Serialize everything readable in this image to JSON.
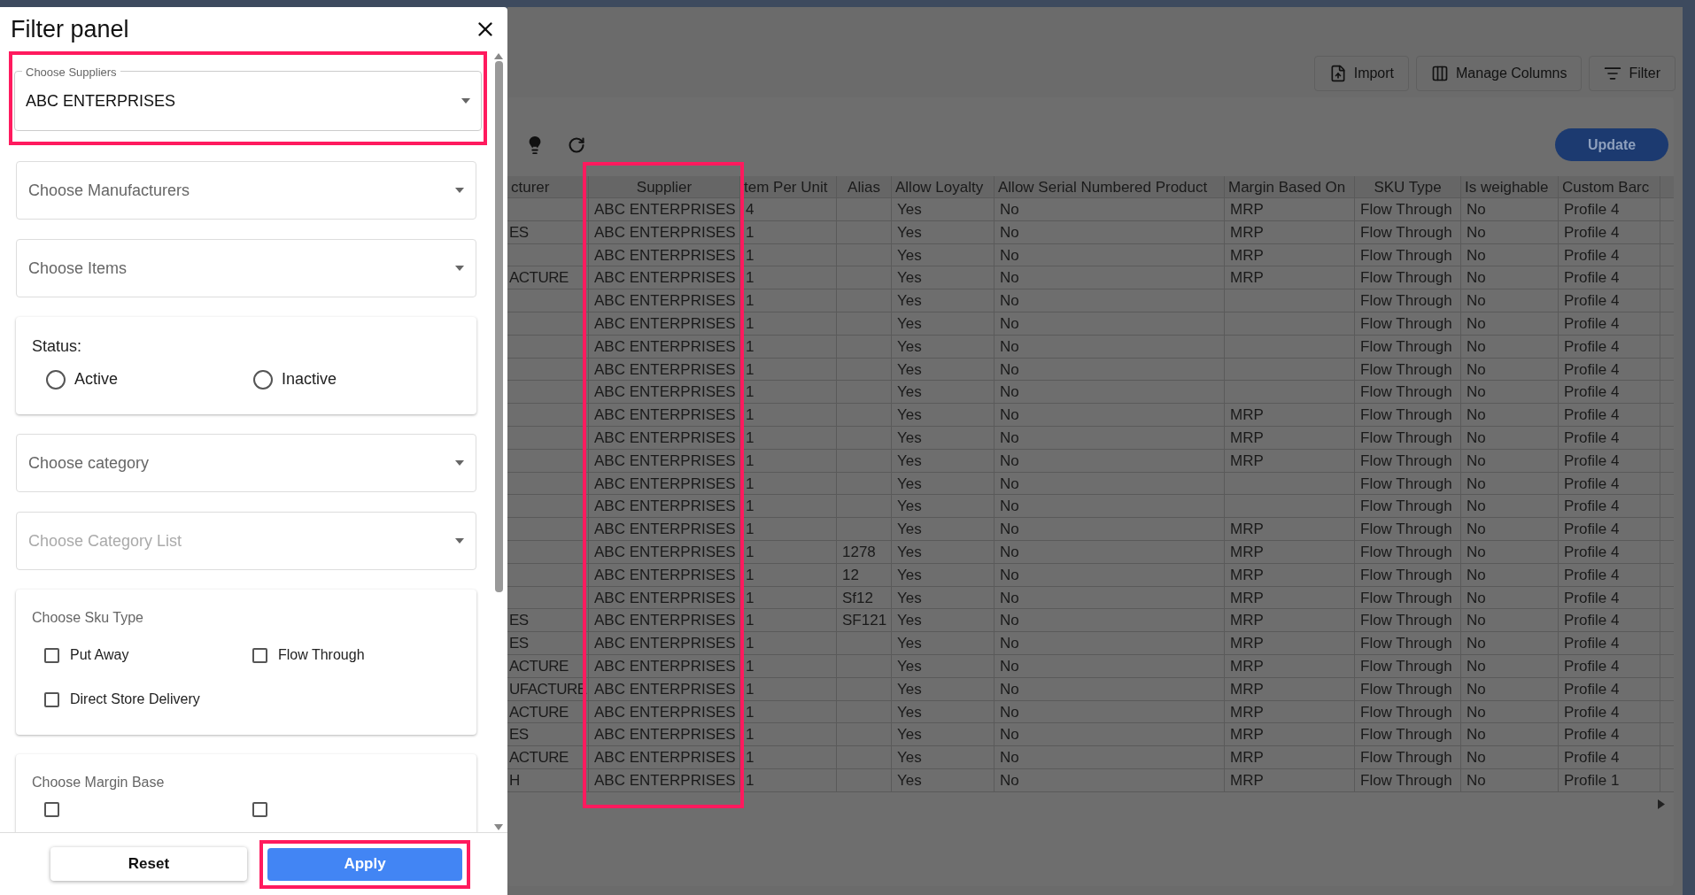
{
  "filter_panel": {
    "title": "Filter panel",
    "suppliers": {
      "label": "Choose Suppliers",
      "value": "ABC ENTERPRISES"
    },
    "selects": [
      {
        "placeholder": "Choose Manufacturers",
        "disabled": false
      },
      {
        "placeholder": "Choose Items",
        "disabled": false
      }
    ],
    "status": {
      "label": "Status:",
      "options": [
        {
          "label": "Active",
          "selected": false
        },
        {
          "label": "Inactive",
          "selected": false
        }
      ]
    },
    "selects_2": [
      {
        "placeholder": "Choose category",
        "disabled": false
      },
      {
        "placeholder": "Choose Category List",
        "disabled": true
      }
    ],
    "sku_type": {
      "label": "Choose Sku Type",
      "options": [
        {
          "label": "Put Away",
          "checked": false
        },
        {
          "label": "Flow Through",
          "checked": false
        },
        {
          "label": "Direct Store Delivery",
          "checked": false
        }
      ]
    },
    "margin_base": {
      "label": "Choose Margin Base",
      "options": [
        {
          "checked": false
        },
        {
          "checked": false
        }
      ]
    },
    "buttons": {
      "reset": "Reset",
      "apply": "Apply"
    }
  },
  "toolbar": {
    "buttons": [
      "Import",
      "Manage Columns",
      "Filter"
    ],
    "update": "Update"
  },
  "table": {
    "columns": [
      "cturer",
      "Supplier",
      "tem Per Unit",
      "Alias",
      "Allow Loyalty",
      "Allow Serial Numbered Product",
      "Margin Based On",
      "SKU Type",
      "Is weighable",
      "Custom Barc"
    ],
    "rows": [
      [
        "",
        "ABC ENTERPRISES",
        "4",
        "",
        "Yes",
        "No",
        "MRP",
        "Flow Through",
        "No",
        "Profile 4"
      ],
      [
        "ES",
        "ABC ENTERPRISES",
        "1",
        "",
        "Yes",
        "No",
        "MRP",
        "Flow Through",
        "No",
        "Profile 4"
      ],
      [
        "",
        "ABC ENTERPRISES",
        "1",
        "",
        "Yes",
        "No",
        "MRP",
        "Flow Through",
        "No",
        "Profile 4"
      ],
      [
        "ACTURE",
        "ABC ENTERPRISES",
        "1",
        "",
        "Yes",
        "No",
        "MRP",
        "Flow Through",
        "No",
        "Profile 4"
      ],
      [
        "",
        "ABC ENTERPRISES",
        "1",
        "",
        "Yes",
        "No",
        "",
        "Flow Through",
        "No",
        "Profile 4"
      ],
      [
        "",
        "ABC ENTERPRISES",
        "1",
        "",
        "Yes",
        "No",
        "",
        "Flow Through",
        "No",
        "Profile 4"
      ],
      [
        "",
        "ABC ENTERPRISES",
        "1",
        "",
        "Yes",
        "No",
        "",
        "Flow Through",
        "No",
        "Profile 4"
      ],
      [
        "",
        "ABC ENTERPRISES",
        "1",
        "",
        "Yes",
        "No",
        "",
        "Flow Through",
        "No",
        "Profile 4"
      ],
      [
        "",
        "ABC ENTERPRISES",
        "1",
        "",
        "Yes",
        "No",
        "",
        "Flow Through",
        "No",
        "Profile 4"
      ],
      [
        "",
        "ABC ENTERPRISES",
        "1",
        "",
        "Yes",
        "No",
        "MRP",
        "Flow Through",
        "No",
        "Profile 4"
      ],
      [
        "",
        "ABC ENTERPRISES",
        "1",
        "",
        "Yes",
        "No",
        "MRP",
        "Flow Through",
        "No",
        "Profile 4"
      ],
      [
        "",
        "ABC ENTERPRISES",
        "1",
        "",
        "Yes",
        "No",
        "MRP",
        "Flow Through",
        "No",
        "Profile 4"
      ],
      [
        "",
        "ABC ENTERPRISES",
        "1",
        "",
        "Yes",
        "No",
        "",
        "Flow Through",
        "No",
        "Profile 4"
      ],
      [
        "",
        "ABC ENTERPRISES",
        "1",
        "",
        "Yes",
        "No",
        "",
        "Flow Through",
        "No",
        "Profile 4"
      ],
      [
        "",
        "ABC ENTERPRISES",
        "1",
        "",
        "Yes",
        "No",
        "MRP",
        "Flow Through",
        "No",
        "Profile 4"
      ],
      [
        "",
        "ABC ENTERPRISES",
        "1",
        "1278",
        "Yes",
        "No",
        "MRP",
        "Flow Through",
        "No",
        "Profile 4"
      ],
      [
        "",
        "ABC ENTERPRISES",
        "1",
        "12",
        "Yes",
        "No",
        "MRP",
        "Flow Through",
        "No",
        "Profile 4"
      ],
      [
        "",
        "ABC ENTERPRISES",
        "1",
        "Sf12",
        "Yes",
        "No",
        "MRP",
        "Flow Through",
        "No",
        "Profile 4"
      ],
      [
        "ES",
        "ABC ENTERPRISES",
        "1",
        "SF121",
        "Yes",
        "No",
        "MRP",
        "Flow Through",
        "No",
        "Profile 4"
      ],
      [
        "ES",
        "ABC ENTERPRISES",
        "1",
        "",
        "Yes",
        "No",
        "MRP",
        "Flow Through",
        "No",
        "Profile 4"
      ],
      [
        "ACTURE",
        "ABC ENTERPRISES",
        "1",
        "",
        "Yes",
        "No",
        "MRP",
        "Flow Through",
        "No",
        "Profile 4"
      ],
      [
        "UFACTURE",
        "ABC ENTERPRISES",
        "1",
        "",
        "Yes",
        "No",
        "MRP",
        "Flow Through",
        "No",
        "Profile 4"
      ],
      [
        "ACTURE",
        "ABC ENTERPRISES",
        "1",
        "",
        "Yes",
        "No",
        "MRP",
        "Flow Through",
        "No",
        "Profile 4"
      ],
      [
        "ES",
        "ABC ENTERPRISES",
        "1",
        "",
        "Yes",
        "No",
        "MRP",
        "Flow Through",
        "No",
        "Profile 4"
      ],
      [
        "ACTURE",
        "ABC ENTERPRISES",
        "1",
        "",
        "Yes",
        "No",
        "MRP",
        "Flow Through",
        "No",
        "Profile 4"
      ],
      [
        "H",
        "ABC ENTERPRISES",
        "1",
        "",
        "Yes",
        "No",
        "MRP",
        "Flow Through",
        "No",
        "Profile 1"
      ]
    ]
  }
}
